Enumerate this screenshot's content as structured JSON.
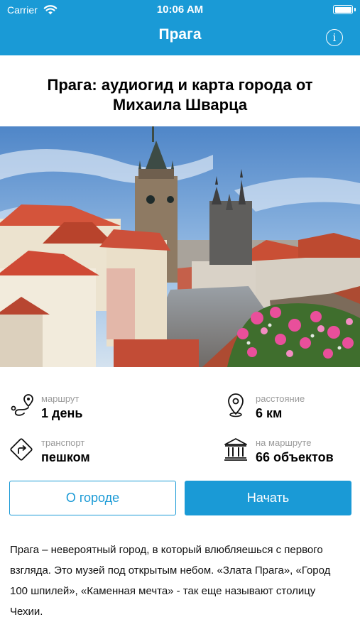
{
  "status_bar": {
    "carrier": "Carrier",
    "time": "10:06 AM"
  },
  "nav": {
    "title": "Прага",
    "info_glyph": "i"
  },
  "title": "Прага: аудиогид и карта города от Михаила Шварца",
  "stats": {
    "route": {
      "label": "маршрут",
      "value": "1 день",
      "icon": "route-icon"
    },
    "distance": {
      "label": "расстояние",
      "value": "6 км",
      "icon": "map-pin-icon"
    },
    "transport": {
      "label": "транспорт",
      "value": "пешком",
      "icon": "turn-sign-icon"
    },
    "objects": {
      "label": "на маршруте",
      "value": "66 объектов",
      "icon": "museum-icon"
    }
  },
  "buttons": {
    "about": "О городе",
    "start": "Начать"
  },
  "description": "Прага – невероятный город, в который влюбляешься с первого взгляда. Это музей под открытым небом. «Злата Прага», «Город 100 шпилей», «Каменная мечта» - так еще называют столицу Чехии.",
  "colors": {
    "accent": "#1a9ad6",
    "label_gray": "#9b9b9b"
  }
}
